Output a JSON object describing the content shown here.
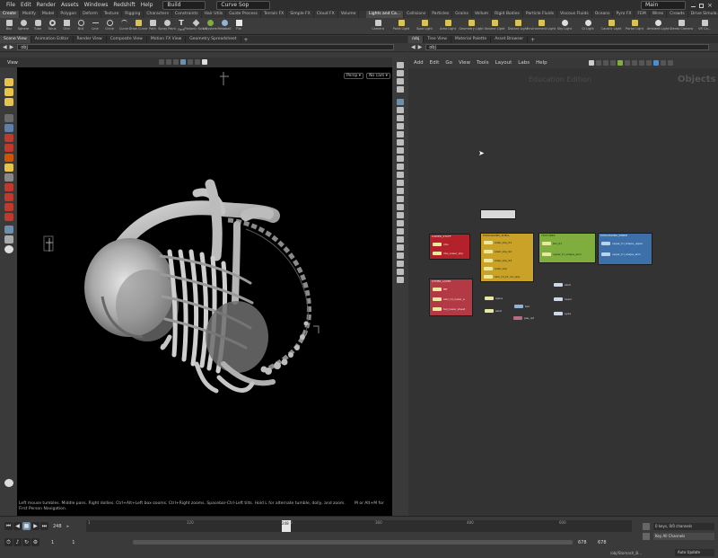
{
  "menubar": {
    "items": [
      "File",
      "Edit",
      "Render",
      "Assets",
      "Windows",
      "Redshift",
      "Help"
    ],
    "desktop": "Build",
    "context": "Curve Sop",
    "main": "Main"
  },
  "shelf_tabs_left": [
    "Create",
    "Modify",
    "Model",
    "Polygon",
    "Deform",
    "Texture",
    "Rigging",
    "Characters",
    "Constraints",
    "Hair Utils",
    "Guide Process",
    "Terrain FX",
    "Simple FX",
    "Cloud FX",
    "Volume"
  ],
  "shelf_tabs_right": [
    "Lights and Ca...",
    "Collisions",
    "Particles",
    "Grains",
    "Vellum",
    "Rigid Bodies",
    "Particle Fluids",
    "Viscous Fluids",
    "Oceans",
    "Pyro FX",
    "FEM",
    "Wires",
    "Crowds",
    "Drive Simula..."
  ],
  "shelf_tools_left": [
    "Box",
    "Sphere",
    "Tube",
    "Torus",
    "Grid",
    "Null",
    "Line",
    "Circle",
    "Curve",
    "Draw Curve",
    "Path",
    "Spray Paint",
    "Font",
    "Platonic Solids",
    "L-System",
    "Metaball",
    "File"
  ],
  "shelf_tools_right": [
    "Camera",
    "Point Light",
    "Spot Light",
    "Area Light",
    "Geometry Light",
    "Volume Light",
    "Distant Light",
    "Environment Light",
    "Sky Light",
    "GI Light",
    "Caustic Light",
    "Portal Light",
    "Ambient Light",
    "Stereo Camera",
    "VR Ca..."
  ],
  "left_pane": {
    "tabs": [
      "Scene View",
      "Animation Editor",
      "Render View",
      "Composite View",
      "Motion FX View",
      "Geometry Spreadsheet"
    ],
    "path": "obj",
    "viewport_label": "View",
    "persp": "Persp ▾",
    "cam": "No cam ▾",
    "hint": "Left mouse tumbles. Middle pans. Right dollies. Ctrl+Alt+Left box-zooms. Ctrl+Right zooms. Spacebar-Ctrl-Left tilts. Hold L for alternate tumble, dolly, and zoom.",
    "hint2": "First Person Navigation.",
    "hint_right": "M or Alt+M for"
  },
  "right_pane": {
    "tabs": [
      "/obj",
      "Tree View",
      "Material Palette",
      "Asset Browser"
    ],
    "path": "obj",
    "menu": [
      "Add",
      "Edit",
      "Go",
      "View",
      "Tools",
      "Layout",
      "Labs",
      "Help"
    ],
    "watermark": "Education Edition",
    "context_label": "Objects"
  },
  "nodes": {
    "red1_title": "LOWER_STUFF",
    "red1_rows": [
      "ribs",
      "ribs_lower_shp"
    ],
    "yellow_title": "EXPLOSIONS_SHELL",
    "yellow_rows": [
      "shell_shp_01",
      "shell_shp_02",
      "shell_shp_03",
      "shell_shp",
      "skin_tri_ht_inn_shp"
    ],
    "green_title": "TEXTURES",
    "green_rows": [
      "tex_01",
      "upper_tri_shape_skin"
    ],
    "blue_title": "EXPLOSIONS_INNER",
    "blue_rows": [
      "upper_tri_shape_upper",
      "upper_tri_shape_skin"
    ],
    "red2_title": "OTHER_LAYER",
    "red2_rows": [
      "ffff",
      "skin_tri_lower_e",
      "tail_lower_sheet"
    ],
    "loose": [
      "spine",
      "skull",
      "tail",
      "jaw_ref",
      "skull",
      "head",
      "eyes"
    ]
  },
  "timeline": {
    "frame": "248",
    "ticks": [
      "1",
      "120",
      "240",
      "360",
      "480",
      "600"
    ],
    "start": "1",
    "start2": "1",
    "end": "678",
    "end2": "678",
    "keys": "0 keys, 0/0 channels",
    "key_all": "Key All Channels",
    "path": "/obj/Stomach_B...",
    "auto_update": "Auto Update"
  },
  "colors": {
    "accent_selected": "#e6c34a",
    "node_red": "#b3222a",
    "node_yellow": "#c9a227",
    "node_green": "#7fae3f",
    "node_blue": "#3d6fa8"
  }
}
